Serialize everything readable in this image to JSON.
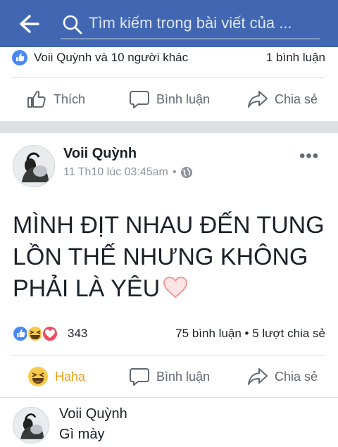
{
  "search": {
    "placeholder": "Tìm kiếm trong bài viết của ..."
  },
  "post1": {
    "likes_text": "Voii Quỳnh và 10 người khác",
    "comments_text": "1 bình luận",
    "actions": {
      "like": "Thích",
      "comment": "Bình luận",
      "share": "Chia sẻ"
    }
  },
  "post2": {
    "author": "Voii Quỳnh",
    "timestamp": "11 Th10 lúc 03:45am",
    "separator": "•",
    "content": "MÌNH ĐỊT NHAU ĐẾN TUNG LỒN THẾ NHƯNG KHÔNG PHẢI LÀ YÊU",
    "reaction_count": "343",
    "stats_text": "75 bình luận • 5 lượt chia sẻ",
    "actions": {
      "haha": "Haha",
      "comment": "Bình luận",
      "share": "Chia sẻ"
    }
  },
  "comment": {
    "author": "Voii Quỳnh",
    "text": "Gì mày"
  },
  "colors": {
    "brand": "#4267b2",
    "haha": "#e9a21e",
    "meta": "#90949c",
    "action": "#606770"
  }
}
